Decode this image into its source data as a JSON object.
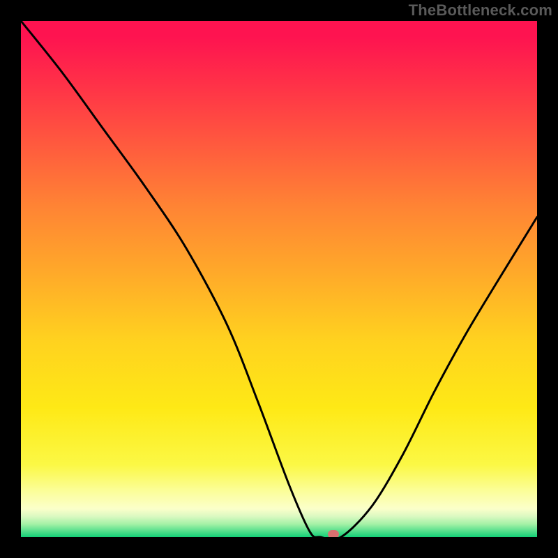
{
  "watermark": "TheBottleneck.com",
  "colors": {
    "background": "#000000",
    "gradient_top": "#fe1350",
    "gradient_mid": "#ffd21f",
    "gradient_bottom": "#12d077",
    "curve_stroke": "#000000",
    "marker_fill": "#d97070"
  },
  "chart_data": {
    "type": "line",
    "title": "",
    "xlabel": "",
    "ylabel": "",
    "xlim": [
      0,
      100
    ],
    "ylim": [
      0,
      100
    ],
    "series": [
      {
        "name": "bottleneck-curve",
        "x": [
          0,
          8,
          16,
          24,
          32,
          40,
          46,
          52,
          56,
          58,
          62,
          68,
          74,
          80,
          86,
          92,
          100
        ],
        "values": [
          100,
          90,
          79,
          68,
          56,
          41,
          26,
          10,
          1,
          0,
          0,
          6,
          16,
          28,
          39,
          49,
          62
        ]
      }
    ],
    "marker": {
      "x": 60.5,
      "y": 0.5
    },
    "background_gradient_stops": [
      {
        "pos": 0,
        "color": "#fe1350"
      },
      {
        "pos": 0.12,
        "color": "#ff3048"
      },
      {
        "pos": 0.24,
        "color": "#ff5a3e"
      },
      {
        "pos": 0.36,
        "color": "#ff8434"
      },
      {
        "pos": 0.48,
        "color": "#ffa72a"
      },
      {
        "pos": 0.62,
        "color": "#ffd21f"
      },
      {
        "pos": 0.75,
        "color": "#fee916"
      },
      {
        "pos": 0.86,
        "color": "#fbf845"
      },
      {
        "pos": 0.91,
        "color": "#fbfe98"
      },
      {
        "pos": 0.945,
        "color": "#fbffca"
      },
      {
        "pos": 0.96,
        "color": "#daf9c1"
      },
      {
        "pos": 0.975,
        "color": "#a4f1a6"
      },
      {
        "pos": 0.988,
        "color": "#58e08d"
      },
      {
        "pos": 1.0,
        "color": "#12d077"
      }
    ]
  }
}
